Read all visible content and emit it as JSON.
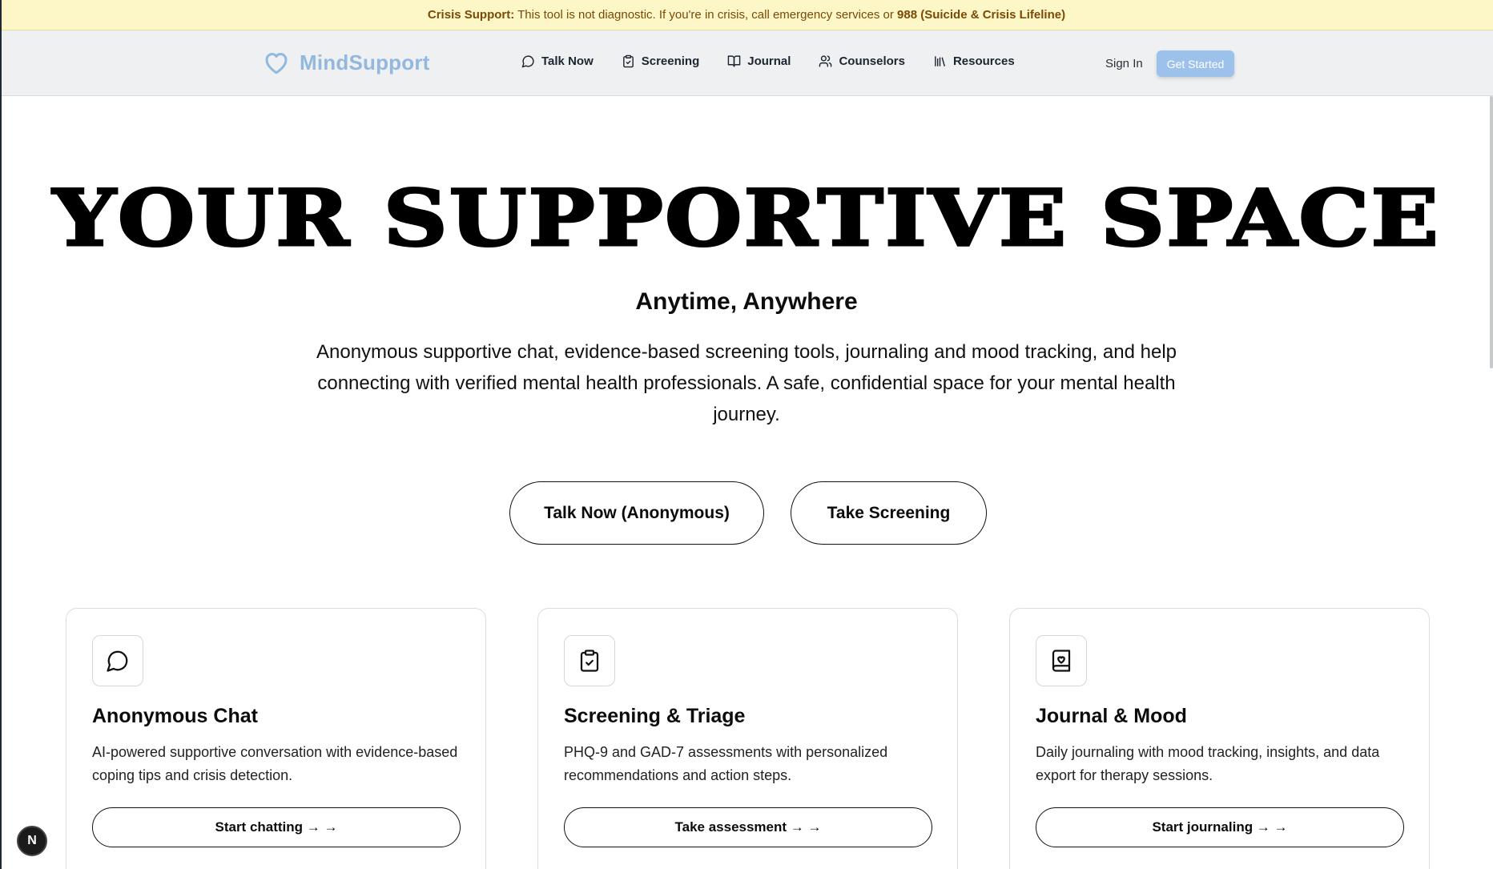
{
  "crisis": {
    "label": "Crisis Support:",
    "text": " This tool is not diagnostic. If you're in crisis, call emergency services or ",
    "hotline": "988 (Suicide & Crisis Lifeline)"
  },
  "nav": {
    "brand": "MindSupport",
    "links": [
      {
        "label": "Talk Now",
        "icon": "chat-bubble-icon"
      },
      {
        "label": "Screening",
        "icon": "clipboard-check-icon"
      },
      {
        "label": "Journal",
        "icon": "book-open-icon"
      },
      {
        "label": "Counselors",
        "icon": "users-icon"
      },
      {
        "label": "Resources",
        "icon": "library-icon"
      }
    ],
    "sign_in": "Sign In",
    "get_started": "Get Started"
  },
  "hero": {
    "title": "YOUR SUPPORTIVE SPACE",
    "subtitle": "Anytime, Anywhere",
    "description": "Anonymous supportive chat, evidence-based screening tools, journaling and mood tracking, and help connecting with verified mental health professionals. A safe, confidential space for your mental health journey.",
    "cta_talk": "Talk Now (Anonymous)",
    "cta_screening": "Take Screening"
  },
  "cards": [
    {
      "icon": "chat-bubble-icon",
      "title": "Anonymous Chat",
      "description": "AI-powered supportive conversation with evidence-based coping tips and crisis detection.",
      "button": "Start chatting → →"
    },
    {
      "icon": "clipboard-check-icon",
      "title": "Screening & Triage",
      "description": "PHQ-9 and GAD-7 assessments with personalized recommendations and action steps.",
      "button": "Take assessment → →"
    },
    {
      "icon": "journal-heart-icon",
      "title": "Journal & Mood",
      "description": "Daily journaling with mood tracking, insights, and data export for therapy sessions.",
      "button": "Start journaling → →"
    }
  ],
  "dev_badge": "N",
  "colors": {
    "crisis_bg": "#fdf6c6",
    "crisis_text": "#7a4a06",
    "brand": "#93b8de",
    "primary_button": "#9cc2ec",
    "nav_bg": "#eef0f2"
  }
}
